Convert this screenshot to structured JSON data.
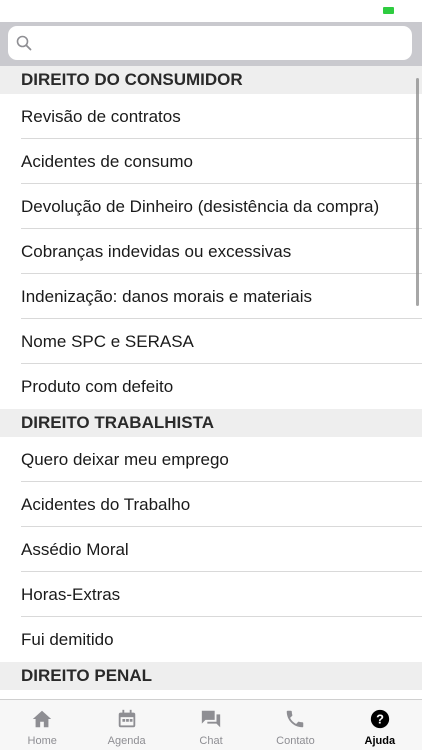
{
  "search": {
    "placeholder": "",
    "value": ""
  },
  "sections": [
    {
      "title": "DIREITO DO CONSUMIDOR",
      "items": [
        "Revisão de contratos",
        "Acidentes de consumo",
        "Devolução de Dinheiro (desistência da compra)",
        "Cobranças indevidas ou excessivas",
        "Indenização: danos morais e materiais",
        "Nome SPC e SERASA",
        "Produto com defeito"
      ]
    },
    {
      "title": "DIREITO TRABALHISTA",
      "items": [
        "Quero deixar meu emprego",
        "Acidentes do Trabalho",
        "Assédio Moral",
        "Horas-Extras",
        "Fui demitido"
      ]
    },
    {
      "title": "DIREITO PENAL",
      "items": []
    }
  ],
  "tabs": [
    {
      "label": "Home",
      "icon": "home-icon"
    },
    {
      "label": "Agenda",
      "icon": "calendar-icon"
    },
    {
      "label": "Chat",
      "icon": "chat-icon"
    },
    {
      "label": "Contato",
      "icon": "phone-icon"
    },
    {
      "label": "Ajuda",
      "icon": "help-icon",
      "active": true
    }
  ],
  "colors": {
    "active_tab": "#000000",
    "inactive_tab": "#8e8e93",
    "battery": "#2ecc40",
    "search_bar_bg": "#c9c9ce",
    "section_header_bg": "#eeeeee"
  }
}
